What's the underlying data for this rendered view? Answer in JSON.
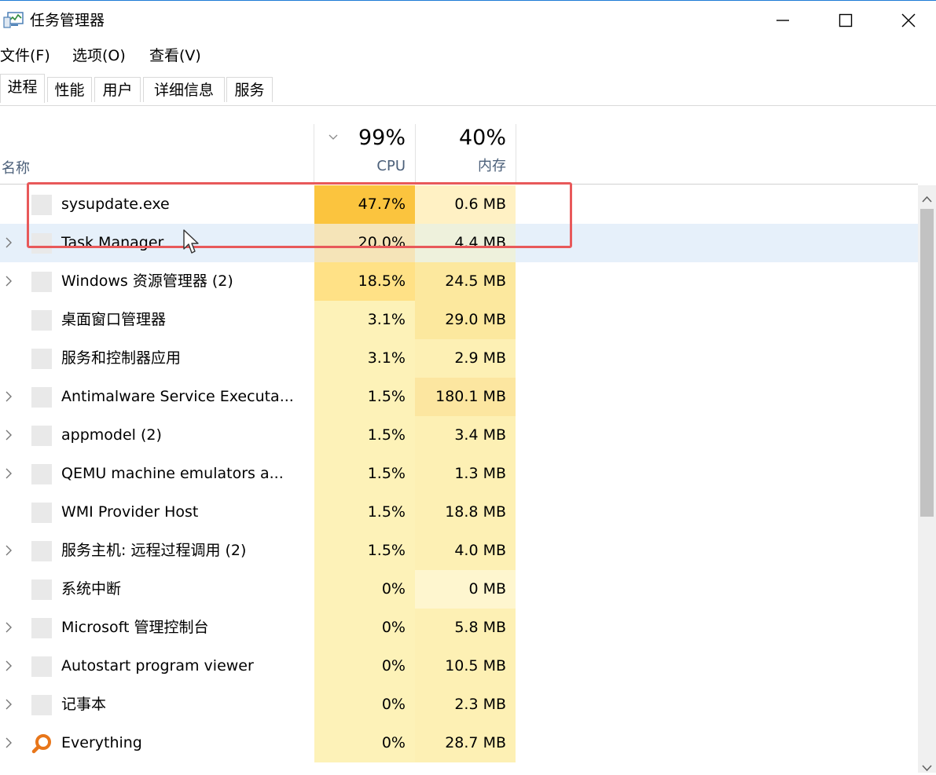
{
  "window": {
    "title": "任务管理器",
    "app_icon": "task-manager-icon",
    "accent_color": "#1e7bd6"
  },
  "menu": [
    "文件(F)",
    "选项(O)",
    "查看(V)"
  ],
  "tabs": [
    "进程",
    "性能",
    "用户",
    "详细信息",
    "服务"
  ],
  "active_tab": "进程",
  "columns": {
    "name": "名称",
    "cpu": {
      "percent": "99%",
      "label": "CPU"
    },
    "memory": {
      "percent": "40%",
      "label": "内存"
    }
  },
  "processes": [
    {
      "name": "sysupdate.exe",
      "cpu": "47.7%",
      "memory": "0.6 MB",
      "expandable": false,
      "cpu_color": "#fbc43e",
      "mem_color": "#fff1c4"
    },
    {
      "name": "Task Manager",
      "cpu": "20.0%",
      "memory": "4.4 MB",
      "expandable": true,
      "cpu_color": "#f5e4b8",
      "mem_color": "#eef1dc"
    },
    {
      "name": "Windows 资源管理器 (2)",
      "cpu": "18.5%",
      "memory": "24.5 MB",
      "expandable": true,
      "cpu_color": "#ffe186",
      "mem_color": "#fce89e"
    },
    {
      "name": "桌面窗口管理器",
      "cpu": "3.1%",
      "memory": "29.0 MB",
      "expandable": false,
      "cpu_color": "#fdf2b8",
      "mem_color": "#fce89e"
    },
    {
      "name": "服务和控制器应用",
      "cpu": "3.1%",
      "memory": "2.9 MB",
      "expandable": false,
      "cpu_color": "#fdf2b8",
      "mem_color": "#fdf0b4"
    },
    {
      "name": "Antimalware Service Executa...",
      "cpu": "1.5%",
      "memory": "180.1 MB",
      "expandable": true,
      "cpu_color": "#fdf2b8",
      "mem_color": "#fce6a0"
    },
    {
      "name": "appmodel (2)",
      "cpu": "1.5%",
      "memory": "3.4 MB",
      "expandable": true,
      "cpu_color": "#fdf2b8",
      "mem_color": "#fdf0b4"
    },
    {
      "name": "QEMU machine emulators a...",
      "cpu": "1.5%",
      "memory": "1.3 MB",
      "expandable": true,
      "cpu_color": "#fdf2b8",
      "mem_color": "#fdf0b4"
    },
    {
      "name": "WMI Provider Host",
      "cpu": "1.5%",
      "memory": "18.8 MB",
      "expandable": false,
      "cpu_color": "#fdf2b8",
      "mem_color": "#fdf0b4"
    },
    {
      "name": "服务主机: 远程过程调用 (2)",
      "cpu": "1.5%",
      "memory": "4.0 MB",
      "expandable": true,
      "cpu_color": "#fdf2b8",
      "mem_color": "#fdf0b4"
    },
    {
      "name": "系统中断",
      "cpu": "0%",
      "memory": "0 MB",
      "expandable": false,
      "cpu_color": "#fdf2b8",
      "mem_color": "#fef6cf"
    },
    {
      "name": "Microsoft 管理控制台",
      "cpu": "0%",
      "memory": "5.8 MB",
      "expandable": true,
      "cpu_color": "#fdf2b8",
      "mem_color": "#fdf0b4"
    },
    {
      "name": "Autostart program viewer",
      "cpu": "0%",
      "memory": "10.5 MB",
      "expandable": true,
      "cpu_color": "#fdf2b8",
      "mem_color": "#fdf0b4"
    },
    {
      "name": "记事本",
      "cpu": "0%",
      "memory": "2.3 MB",
      "expandable": true,
      "cpu_color": "#fdf2b8",
      "mem_color": "#fdf0b4"
    },
    {
      "name": "Everything",
      "cpu": "0%",
      "memory": "28.7 MB",
      "expandable": true,
      "cpu_color": "#fdf2b8",
      "mem_color": "#fdf0b4",
      "icon": "everything-magnifier-icon"
    }
  ],
  "selected_process": "Task Manager",
  "annotation": {
    "color": "#e8595a"
  }
}
